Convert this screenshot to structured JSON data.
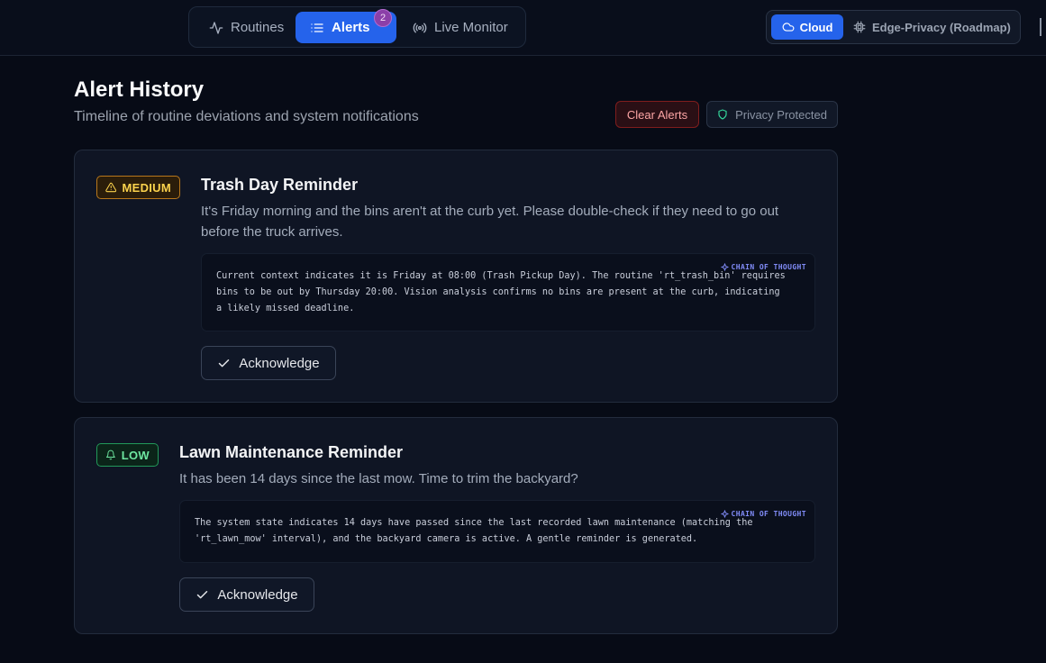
{
  "nav": {
    "routines": "Routines",
    "alerts": "Alerts",
    "alerts_count": "2",
    "live_monitor": "Live Monitor"
  },
  "mode": {
    "cloud": "Cloud",
    "edge": "Edge-Privacy (Roadmap)"
  },
  "header": {
    "title": "Alert History",
    "subtitle": "Timeline of routine deviations and system notifications",
    "clear_button": "Clear Alerts",
    "privacy_label": "Privacy Protected"
  },
  "alerts": [
    {
      "severity": "MEDIUM",
      "title": "Trash Day Reminder",
      "message": "It's Friday morning and the bins aren't at the curb yet. Please double-check if they need to go out before the truck arrives.",
      "cot_label": "CHAIN OF THOUGHT",
      "chain_of_thought": "Current context indicates it is Friday at 08:00 (Trash Pickup Day). The routine 'rt_trash_bin' requires bins to be out by Thursday 20:00. Vision analysis confirms no bins are present at the curb, indicating a likely missed deadline.",
      "ack_label": "Acknowledge"
    },
    {
      "severity": "LOW",
      "title": "Lawn Maintenance Reminder",
      "message": "It has been 14 days since the last mow. Time to trim the backyard?",
      "cot_label": "CHAIN OF THOUGHT",
      "chain_of_thought": "The system state indicates 14 days have passed since the last recorded lawn maintenance (matching the 'rt_lawn_mow' interval), and the backyard camera is active. A gentle reminder is generated.",
      "ack_label": "Acknowledge"
    }
  ],
  "colors": {
    "accent": "#2563eb",
    "medium": "#fcd34d",
    "low": "#6ee7a1",
    "danger": "#fca5a5"
  }
}
